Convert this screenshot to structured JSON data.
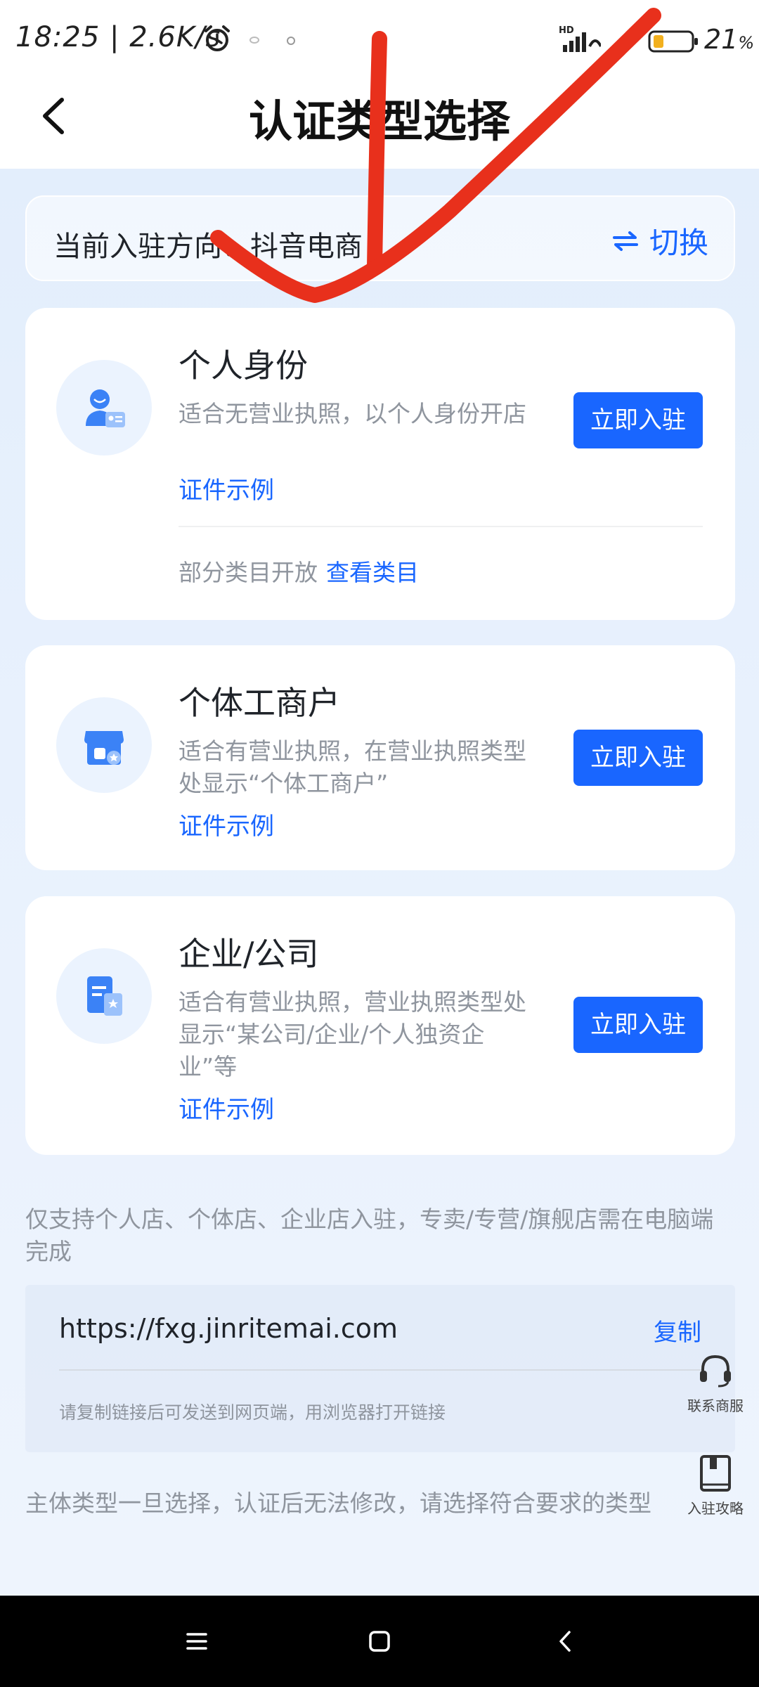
{
  "status_bar": {
    "time": "18:25",
    "speed": "2.6K/s",
    "hd": "HD",
    "battery_pct": "21",
    "battery_unit": "%"
  },
  "header": {
    "title": "认证类型选择"
  },
  "direction": {
    "label": "当前入驻方向：抖音电商",
    "switch_label": "切换"
  },
  "cards": [
    {
      "title": "个人身份",
      "desc": "适合无营业执照，以个人身份开店",
      "example": "证件示例",
      "button": "立即入驻",
      "foot_text": "部分类目开放",
      "foot_link": "查看类目"
    },
    {
      "title": "个体工商户",
      "desc": "适合有营业执照，在营业执照类型处显示“个体工商户”",
      "example": "证件示例",
      "button": "立即入驻"
    },
    {
      "title": "企业/公司",
      "desc": "适合有营业执照，营业执照类型处显示“某公司/企业/个人独资企业”等",
      "example": "证件示例",
      "button": "立即入驻"
    }
  ],
  "notice": "仅支持个人店、个体店、企业店入驻，专卖/专营/旗舰店需在电脑端完成",
  "link_box": {
    "url": "https://fxg.jinritemai.com",
    "copy": "复制",
    "hint": "请复制链接后可发送到网页端，用浏览器打开链接"
  },
  "float_buttons": {
    "service": "联系商服",
    "guide": "入驻攻略"
  },
  "footer_note": "主体类型一旦选择，认证后无法修改，请选择符合要求的类型",
  "colors": {
    "accent": "#1966ff",
    "annotation": "#e8301c"
  }
}
